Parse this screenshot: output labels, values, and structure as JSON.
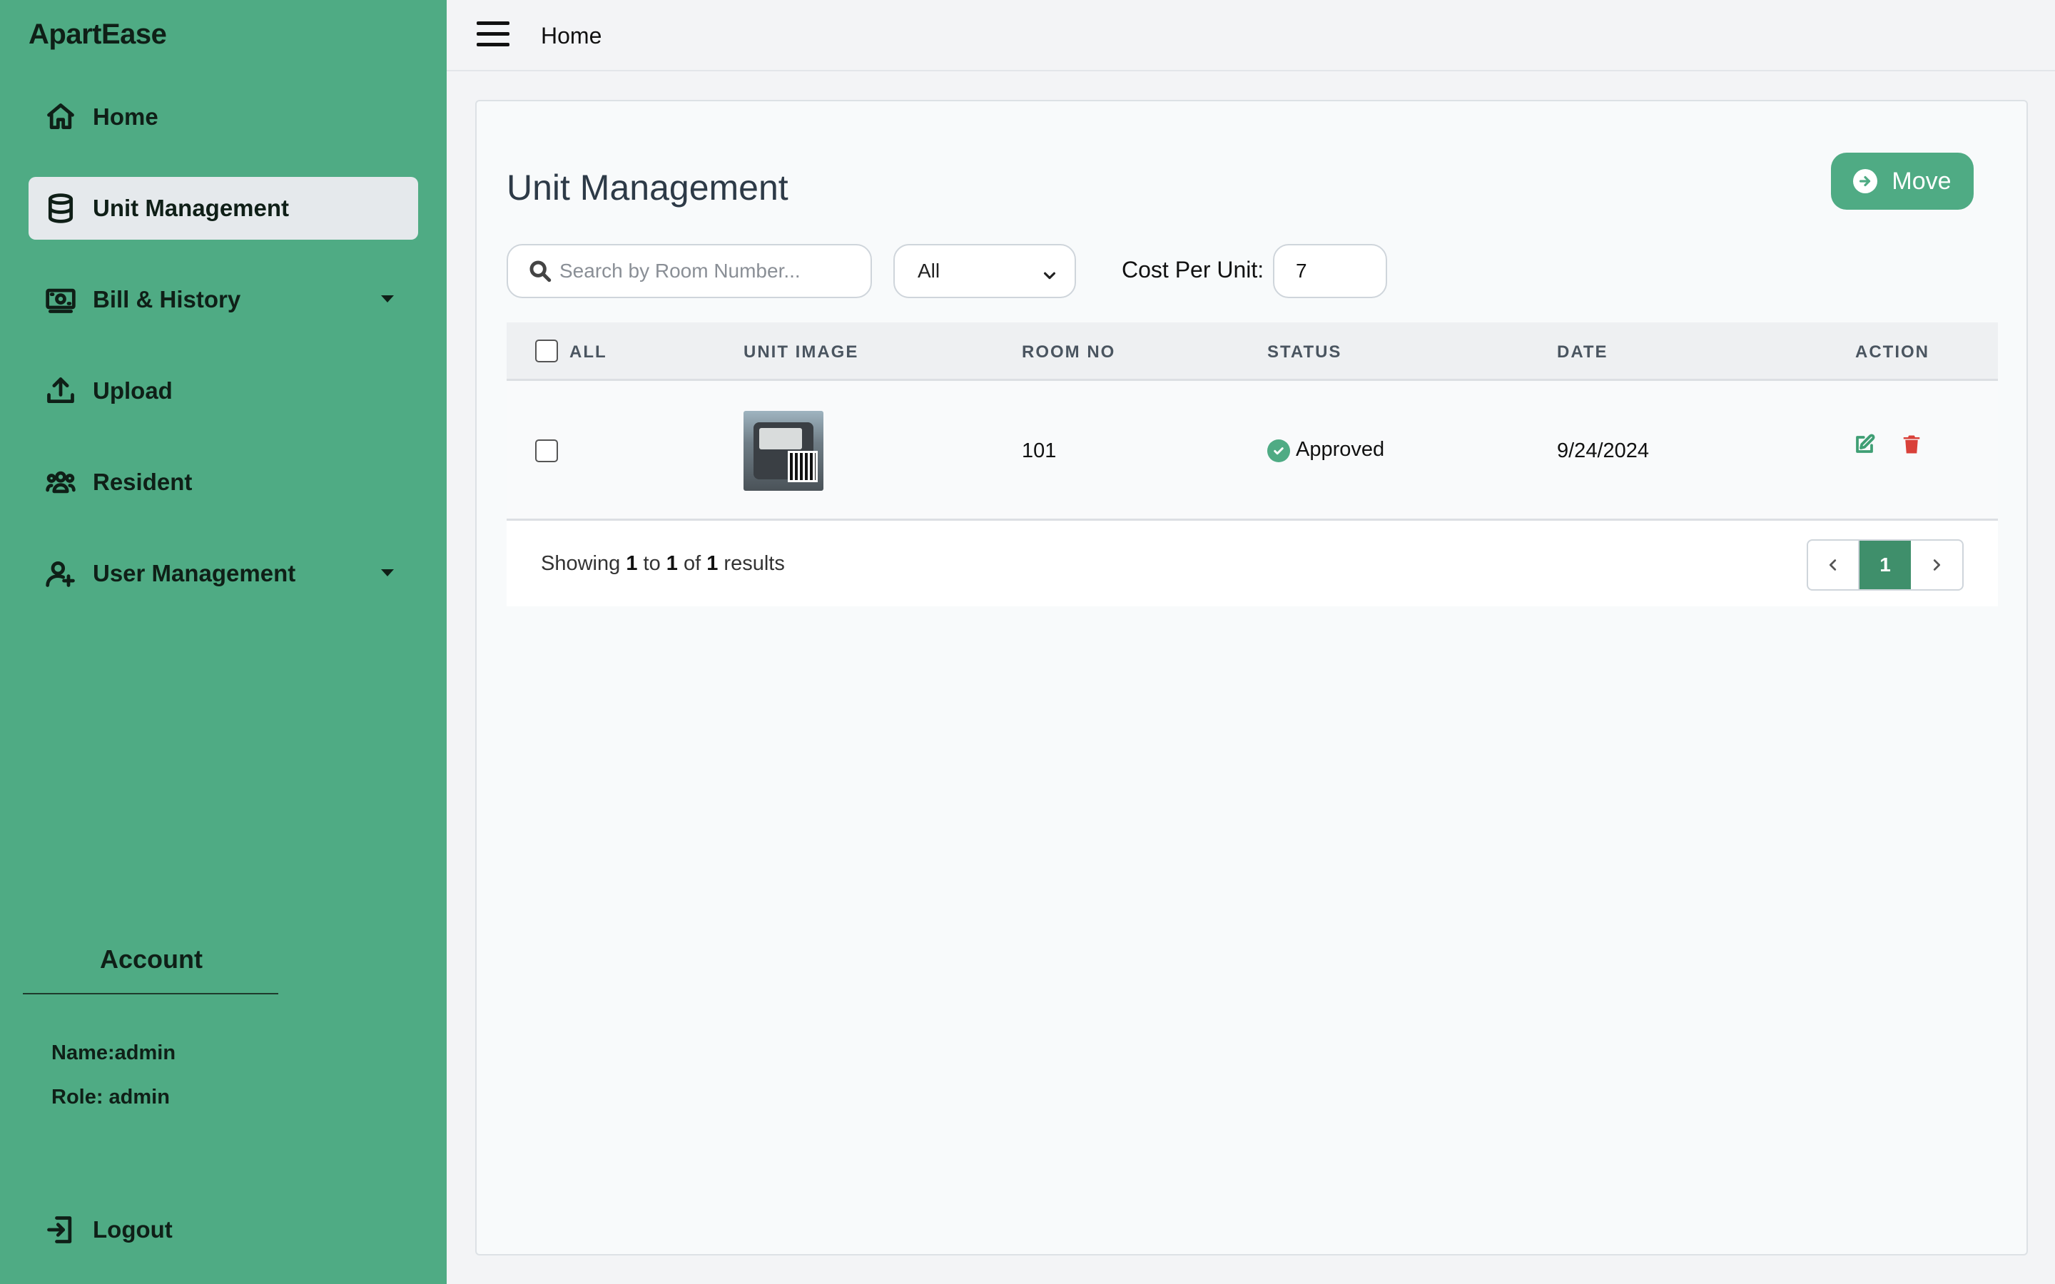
{
  "app": {
    "brand": "ApartEase"
  },
  "colors": {
    "sidebar": "#4fab84",
    "accent": "#4fab84",
    "active_page": "#3f8f6b",
    "delete": "#d9413a"
  },
  "sidebar": {
    "items": [
      {
        "label": "Home",
        "icon": "home-icon",
        "active": false,
        "has_dropdown": false
      },
      {
        "label": "Unit Management",
        "icon": "database-icon",
        "active": true,
        "has_dropdown": false
      },
      {
        "label": "Bill & History",
        "icon": "money-icon",
        "active": false,
        "has_dropdown": true
      },
      {
        "label": "Upload",
        "icon": "upload-icon",
        "active": false,
        "has_dropdown": false
      },
      {
        "label": "Resident",
        "icon": "users-icon",
        "active": false,
        "has_dropdown": false
      },
      {
        "label": "User Management",
        "icon": "user-plus-icon",
        "active": false,
        "has_dropdown": true
      }
    ],
    "account": {
      "title": "Account",
      "name": "Name:admin",
      "role": "Role: admin"
    },
    "logout": {
      "label": "Logout",
      "icon": "logout-icon"
    }
  },
  "topbar": {
    "title": "Home",
    "menu_icon": "hamburger-icon"
  },
  "main": {
    "title": "Unit Management",
    "move_button": "Move",
    "search": {
      "placeholder": "Search by Room Number...",
      "value": ""
    },
    "filter": {
      "selected": "All"
    },
    "cost_per_unit": {
      "label": "Cost Per Unit:",
      "value": "7"
    },
    "table": {
      "headers": {
        "all": "ALL",
        "unit_image": "UNIT IMAGE",
        "room_no": "ROOM NO",
        "status": "STATUS",
        "date": "DATE",
        "action": "ACTION"
      },
      "rows": [
        {
          "room_no": "101",
          "status": "Approved",
          "date": "9/24/2024",
          "checked": false
        }
      ]
    },
    "pagination": {
      "prefix": "Showing",
      "from": "1",
      "to_word": "to",
      "to": "1",
      "of_word": "of",
      "total": "1",
      "suffix": "results",
      "current_page": "1"
    }
  }
}
